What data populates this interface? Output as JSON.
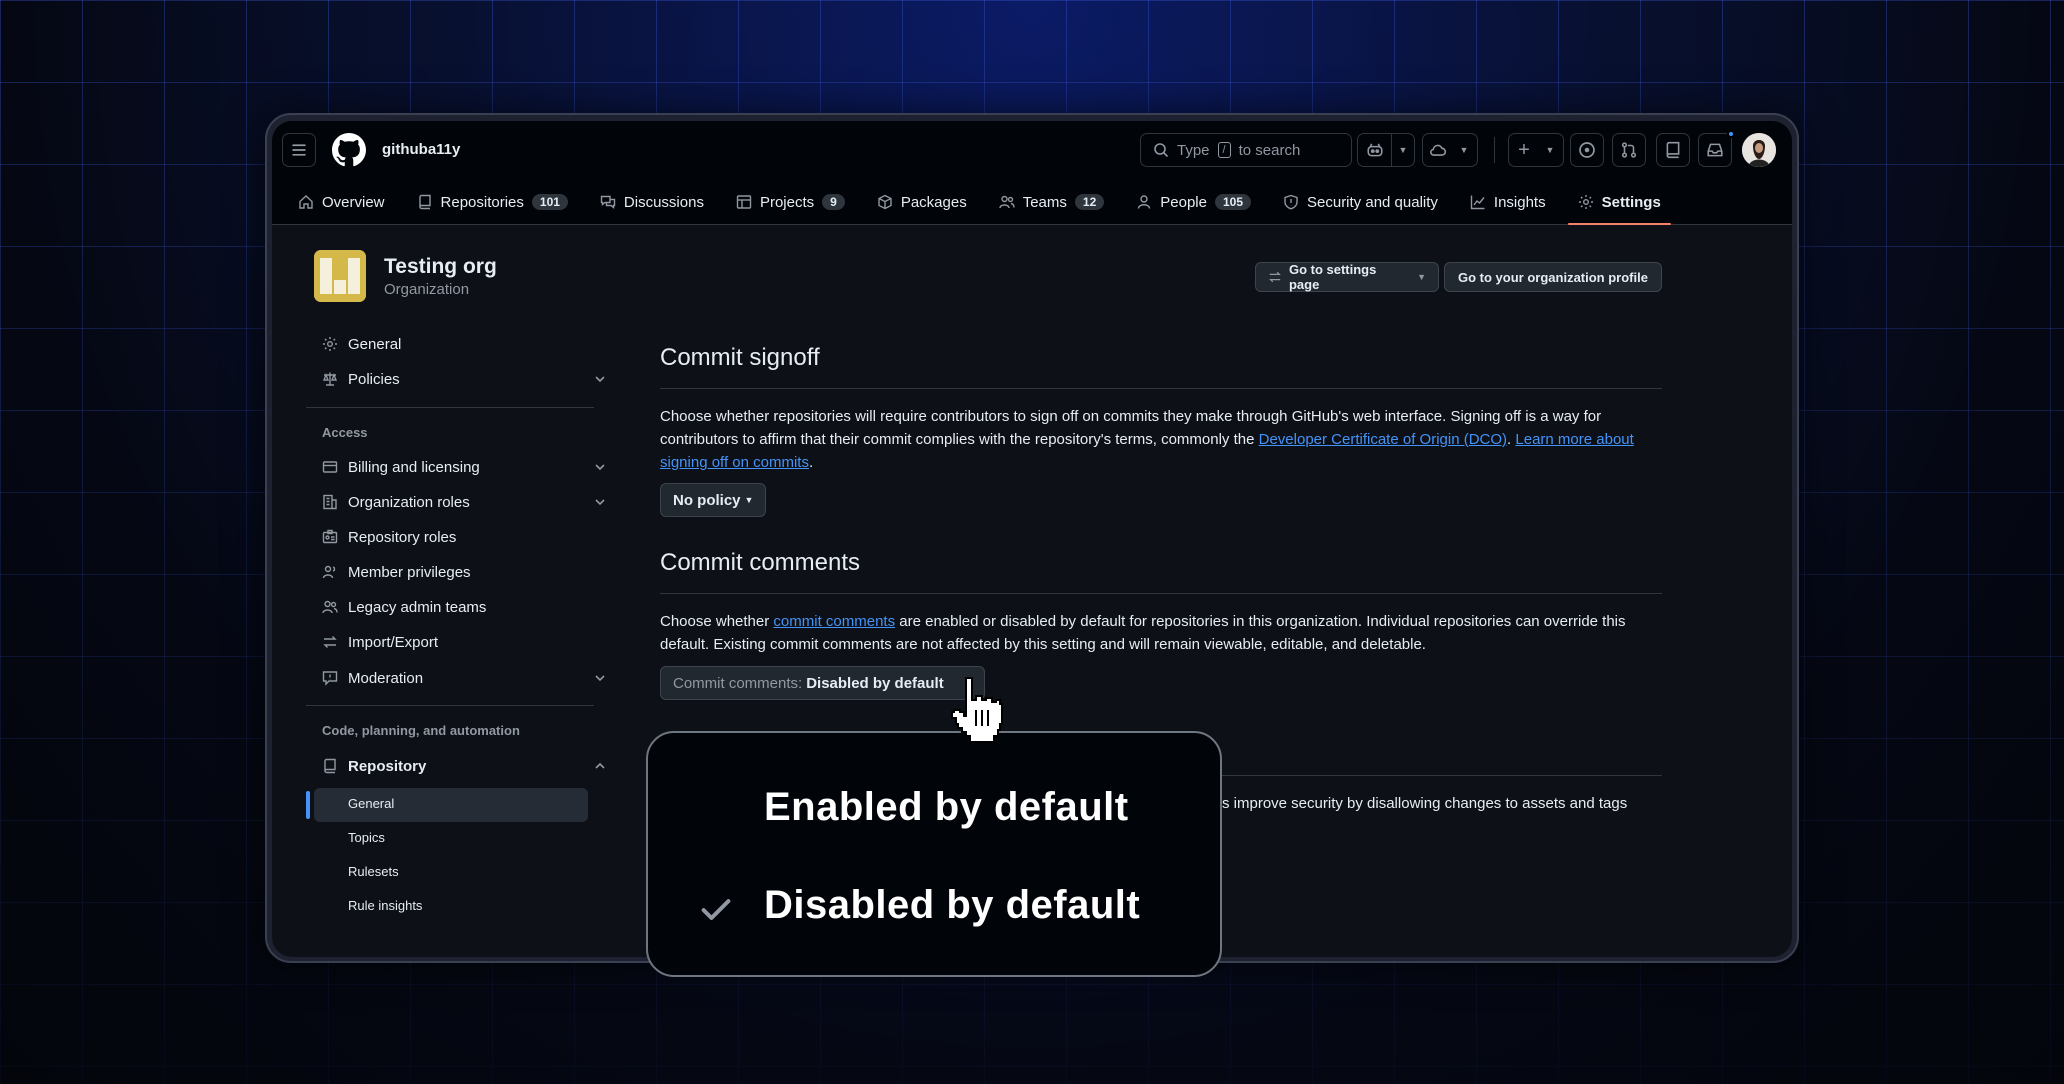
{
  "header": {
    "org_name": "githuba11y",
    "search_text": "Type",
    "search_key": "/",
    "search_suffix": "to search"
  },
  "tabs": [
    {
      "label": "Overview",
      "icon": "home-icon"
    },
    {
      "label": "Repositories",
      "count": "101",
      "icon": "repo-icon"
    },
    {
      "label": "Discussions",
      "icon": "comment-discussion-icon"
    },
    {
      "label": "Projects",
      "count": "9",
      "icon": "table-icon"
    },
    {
      "label": "Packages",
      "icon": "package-icon"
    },
    {
      "label": "Teams",
      "count": "12",
      "icon": "people-icon"
    },
    {
      "label": "People",
      "count": "105",
      "icon": "person-icon"
    },
    {
      "label": "Security and quality",
      "icon": "shield-icon"
    },
    {
      "label": "Insights",
      "icon": "graph-icon"
    },
    {
      "label": "Settings",
      "icon": "gear-icon",
      "active": true
    }
  ],
  "org": {
    "title": "Testing org",
    "subtitle": "Organization",
    "settings_button": "Go to settings page",
    "profile_button": "Go to your organization profile"
  },
  "sidebar": {
    "general": "General",
    "policies": "Policies",
    "access_heading": "Access",
    "billing": "Billing and licensing",
    "org_roles": "Organization roles",
    "repo_roles": "Repository roles",
    "member_privileges": "Member privileges",
    "legacy_admin": "Legacy admin teams",
    "import_export": "Import/Export",
    "moderation": "Moderation",
    "code_heading": "Code, planning, and automation",
    "repository": "Repository",
    "sub_items": [
      "General",
      "Topics",
      "Rulesets",
      "Rule insights"
    ]
  },
  "main": {
    "signoff_title": "Commit signoff",
    "signoff_text_1": "Choose whether repositories will require contributors to sign off on commits they make through GitHub's web interface. Signing off is a way for contributors to affirm that their commit complies with the repository's terms, commonly the ",
    "signoff_link_dco": "Developer Certificate of Origin (DCO)",
    "signoff_text_2": ". ",
    "signoff_link_learn": "Learn more about signing off on commits",
    "signoff_text_3": ".",
    "no_policy_button": "No policy",
    "comments_title": "Commit comments",
    "comments_text_1": "Choose whether ",
    "comments_link": "commit comments",
    "comments_text_2": " are enabled or disabled by default for repositories in this organization. Individual repositories can override this default. Existing commit comments are not affected by this setting and will remain viewable, editable, and deletable.",
    "comments_dd_prefix": "Commit comments:",
    "comments_dd_value": "Disabled by default",
    "partial_text": "s improve security by disallowing changes to assets and tags"
  },
  "popover": {
    "options": [
      "Enabled by default",
      "Disabled by default"
    ],
    "selected_index": 1
  },
  "colors": {
    "accent_link": "#4493f8",
    "active_tab_underline": "#f78166",
    "org_logo": "#d4b84a"
  }
}
